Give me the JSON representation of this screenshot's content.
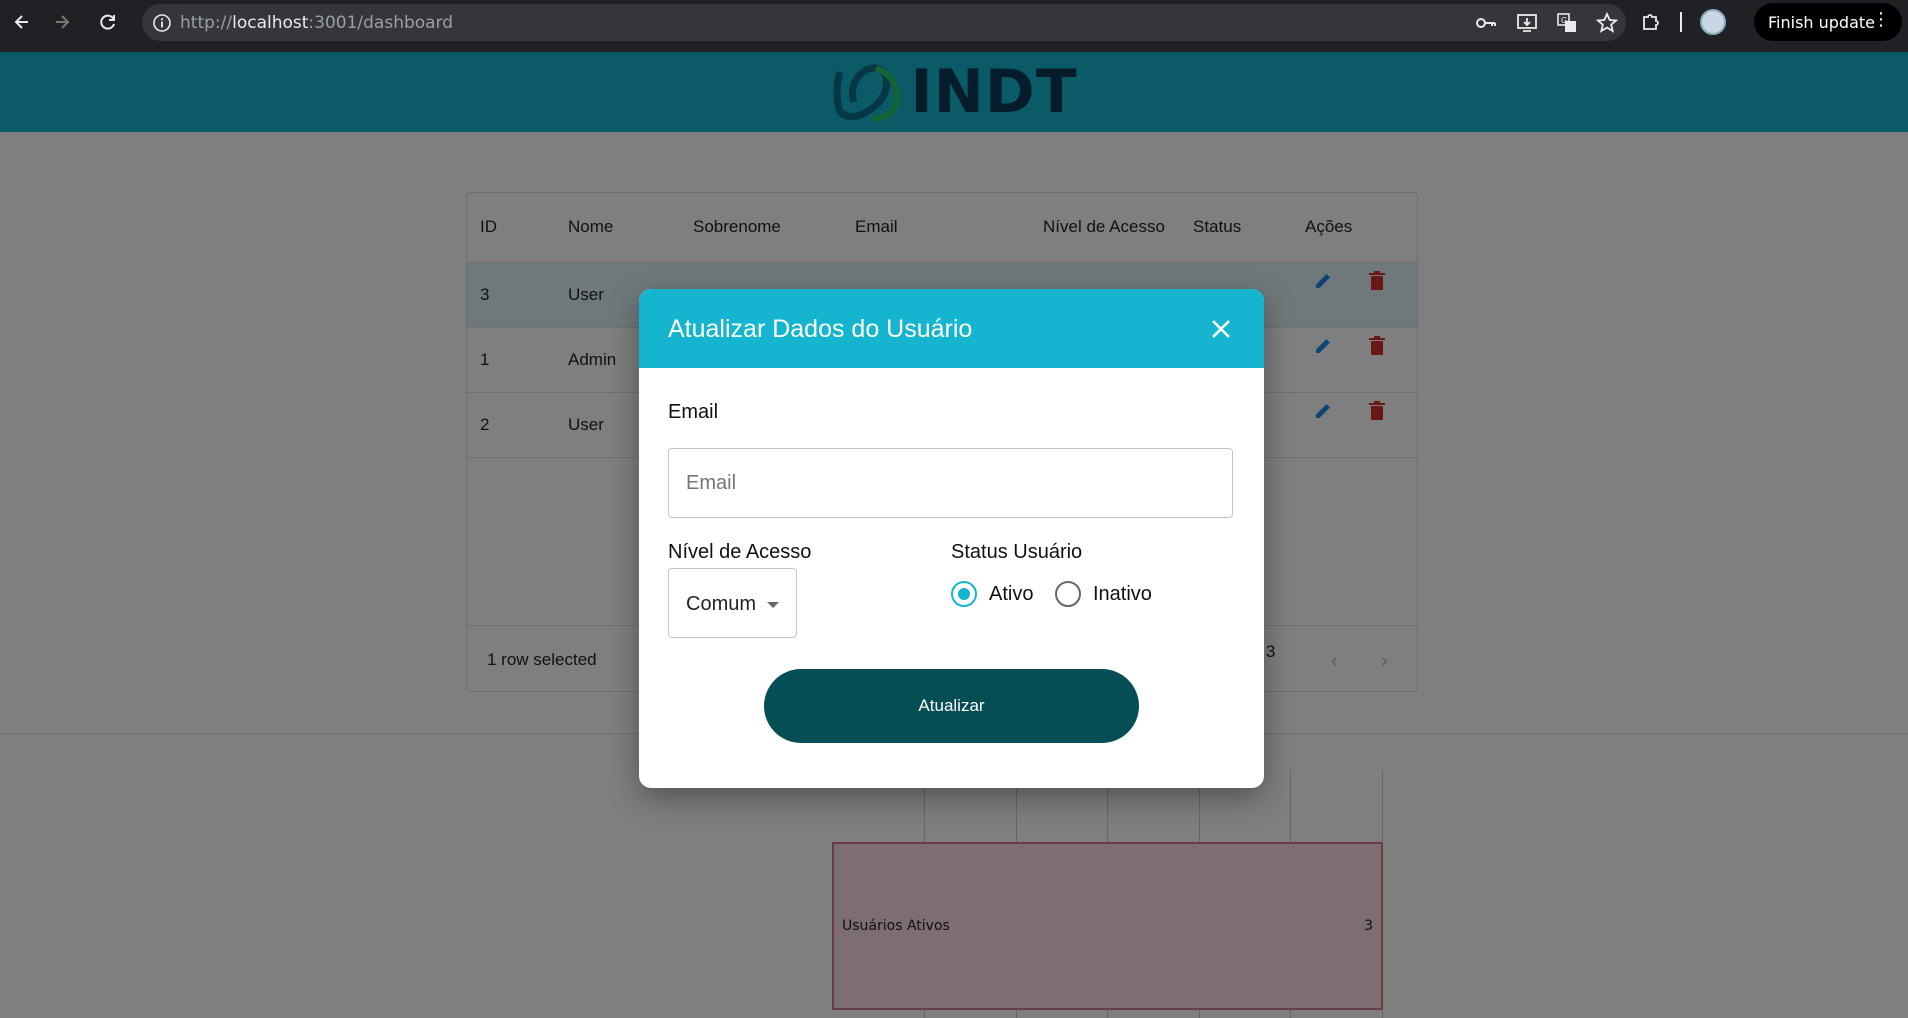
{
  "browser": {
    "url_scheme": "http://",
    "url_host": "localhost",
    "url_path": ":3001/dashboard",
    "finish_update_label": "Finish update"
  },
  "header": {
    "logo_text": "INDT",
    "bg_color": "#15b5d0"
  },
  "table": {
    "columns": [
      "ID",
      "Nome",
      "Sobrenome",
      "Email",
      "Nível de Acesso",
      "Status",
      "Ações"
    ],
    "rows": [
      {
        "id": "3",
        "nome": "User",
        "selected": true
      },
      {
        "id": "1",
        "nome": "Admin",
        "selected": false
      },
      {
        "id": "2",
        "nome": "User",
        "selected": false
      }
    ],
    "footer": {
      "selected_text": "1 row selected",
      "pagination_text": "of 3"
    }
  },
  "chart": {
    "bar_label": "Usuários Ativos",
    "bar_value": "3"
  },
  "modal": {
    "title": "Atualizar Dados do Usuário",
    "email_label": "Email",
    "email_placeholder": "Email",
    "access_label": "Nível de Acesso",
    "access_value": "Comum",
    "status_label": "Status Usuário",
    "status_options": [
      {
        "label": "Ativo",
        "checked": true
      },
      {
        "label": "Inativo",
        "checked": false
      }
    ],
    "submit_label": "Atualizar"
  },
  "colors": {
    "accent": "#15b5d0",
    "button": "#064e55",
    "delete": "#d32f2f",
    "edit": "#1e88e5"
  }
}
